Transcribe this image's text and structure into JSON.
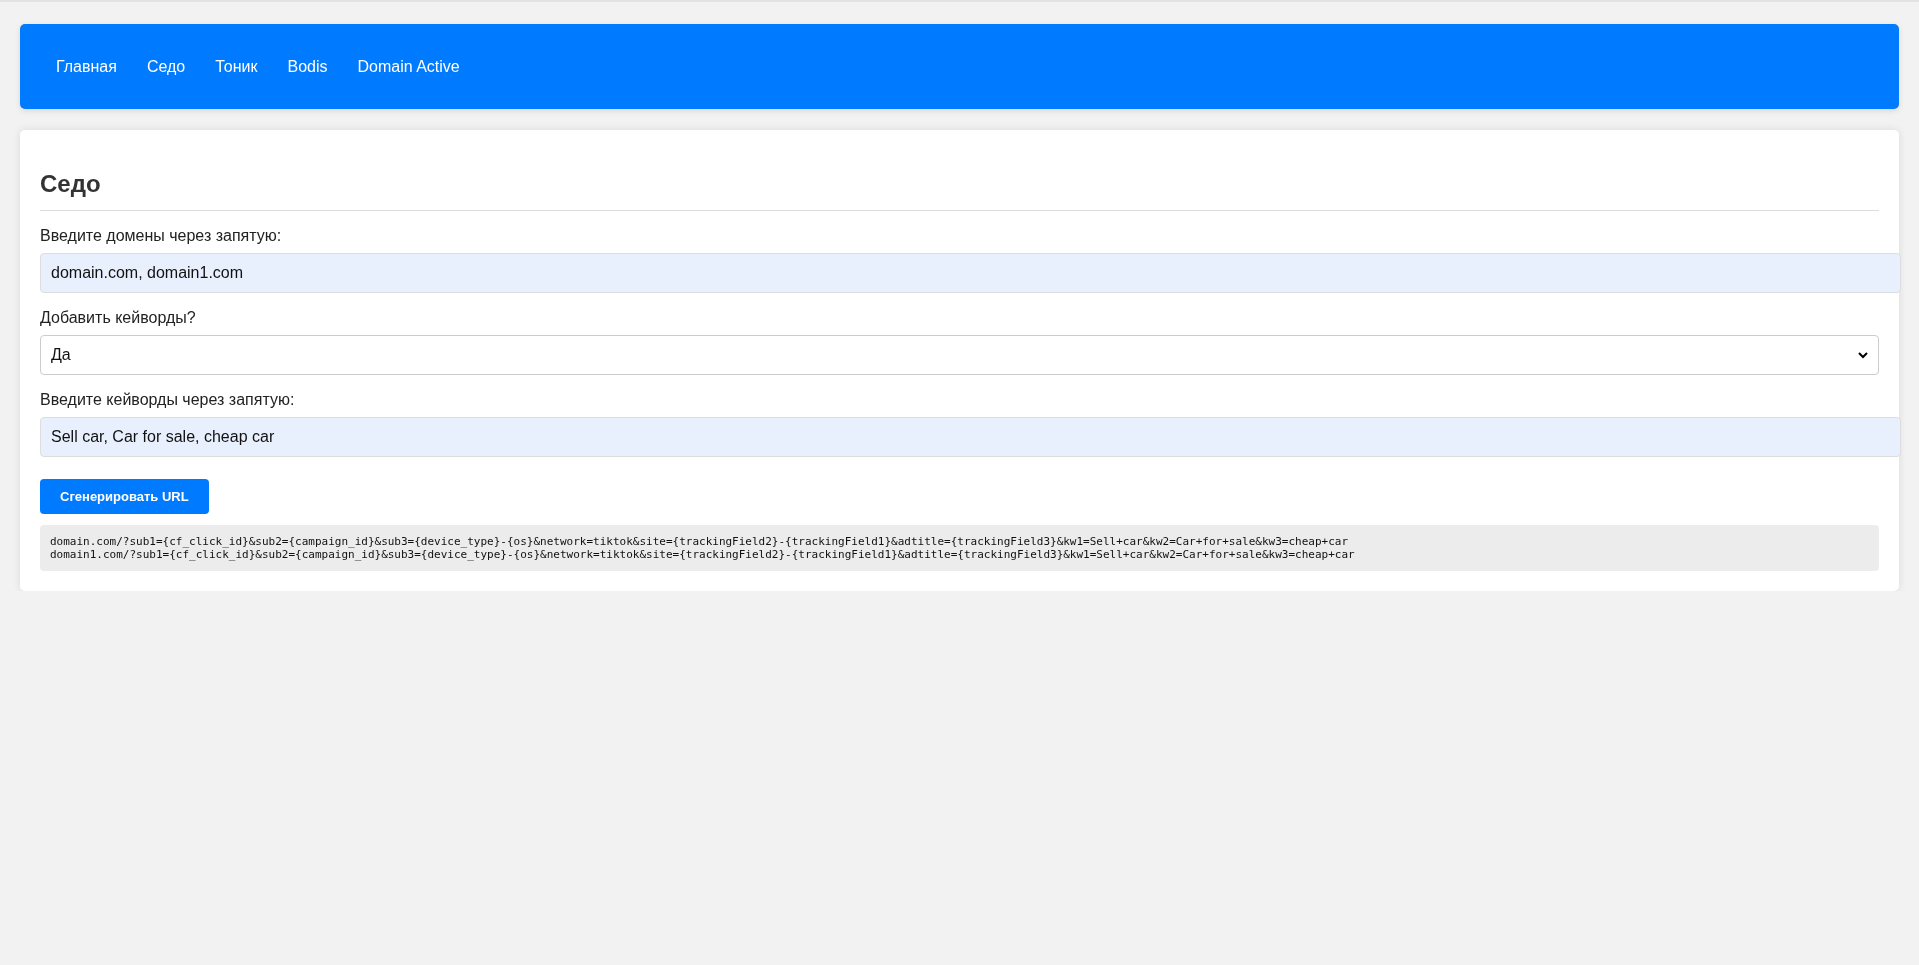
{
  "nav": {
    "items": [
      {
        "label": "Главная"
      },
      {
        "label": "Седо"
      },
      {
        "label": "Тоник"
      },
      {
        "label": "Bodis"
      },
      {
        "label": "Domain Active"
      }
    ]
  },
  "form": {
    "title": "Седо",
    "fields": [
      {
        "kind": "text",
        "label": "Введите домены через запятую:",
        "value": "domain.com, domain1.com"
      },
      {
        "kind": "select",
        "label": "Добавить кейворды?",
        "value": "Да"
      },
      {
        "kind": "text",
        "label": "Введите кейворды через запятую:",
        "value": "Sell car, Car for sale, cheap car"
      }
    ],
    "button": "Сгенерировать URL",
    "output": [
      "domain.com/?sub1={cf_click_id}&sub2={campaign_id}&sub3={device_type}-{os}&network=tiktok&site={trackingField2}-{trackingField1}&adtitle={trackingField3}&kw1=Sell+car&kw2=Car+for+sale&kw3=cheap+car",
      "domain1.com/?sub1={cf_click_id}&sub2={campaign_id}&sub3={device_type}-{os}&network=tiktok&site={trackingField2}-{trackingField1}&adtitle={trackingField3}&kw1=Sell+car&kw2=Car+for+sale&kw3=cheap+car"
    ]
  }
}
